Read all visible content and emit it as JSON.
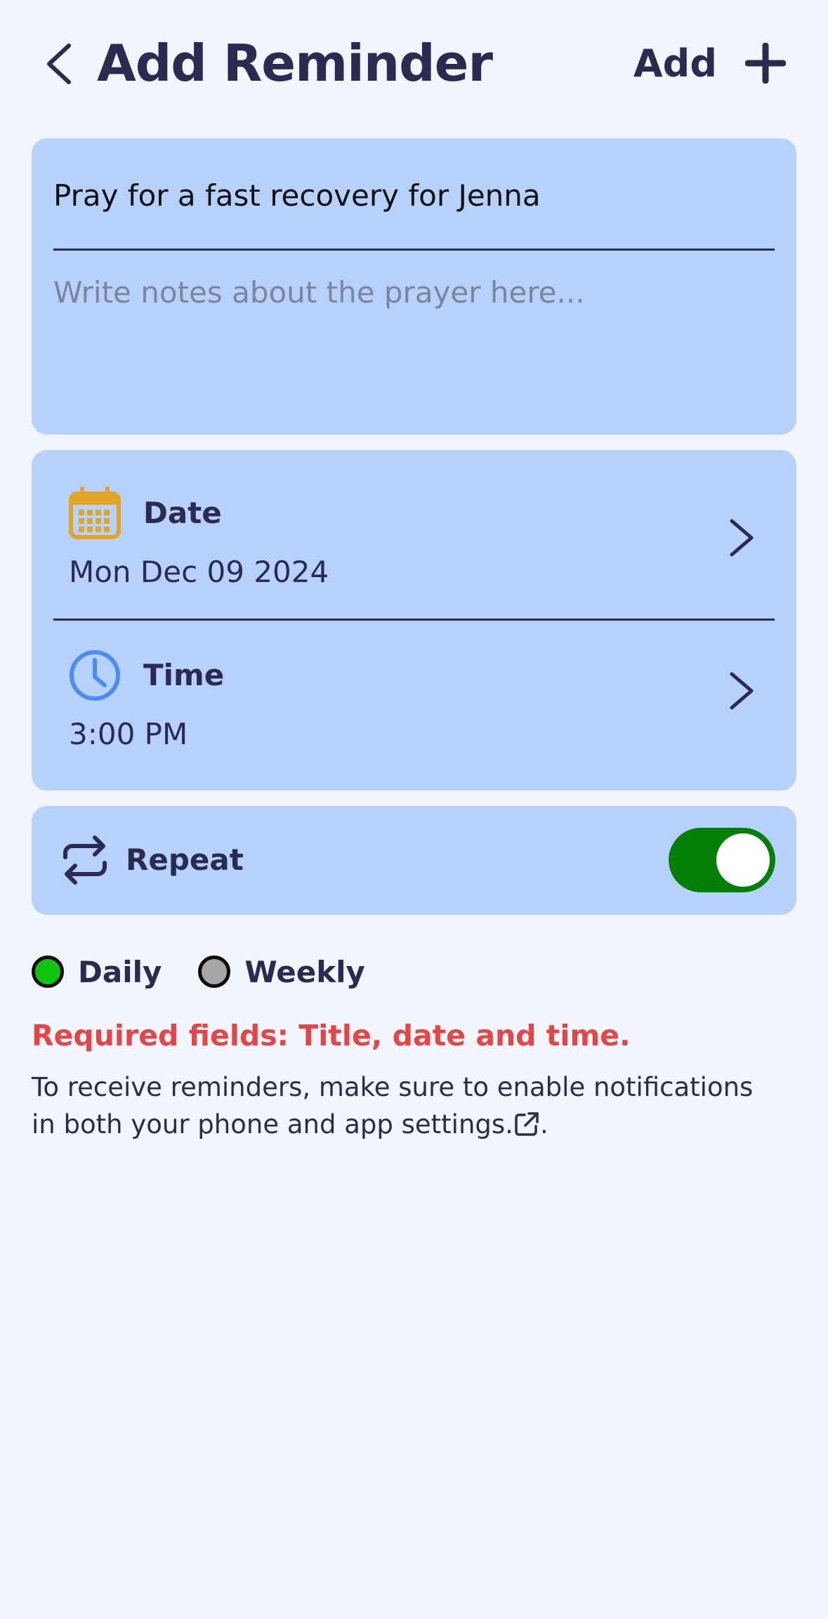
{
  "header": {
    "title": "Add Reminder",
    "add_label": "Add"
  },
  "prayer": {
    "title": "Pray for a fast recovery for Jenna",
    "notes_placeholder": "Write notes about the prayer here..."
  },
  "date_row": {
    "label": "Date",
    "value": "Mon Dec 09 2024",
    "icon": "calendar-icon"
  },
  "time_row": {
    "label": "Time",
    "value": "3:00 PM",
    "icon": "clock-icon"
  },
  "repeat": {
    "label": "Repeat",
    "enabled": true,
    "options": [
      {
        "label": "Daily",
        "selected": true
      },
      {
        "label": "Weekly",
        "selected": false
      }
    ]
  },
  "messages": {
    "required": "Required fields: Title, date and time.",
    "info_before_link": "To receive reminders, make sure to enable notifications in both your phone and app settings.",
    "info_after_link": "."
  },
  "colors": {
    "background": "#f0f5fe",
    "card": "#b6d2fc",
    "primary_text": "#2b2b52",
    "toggle_on": "#057f05",
    "daily_dot": "#0fc50f",
    "weekly_dot": "#a7a5a5",
    "error": "#e64545",
    "calendar_icon": "#e0a526",
    "clock_icon": "#4a8df2"
  }
}
